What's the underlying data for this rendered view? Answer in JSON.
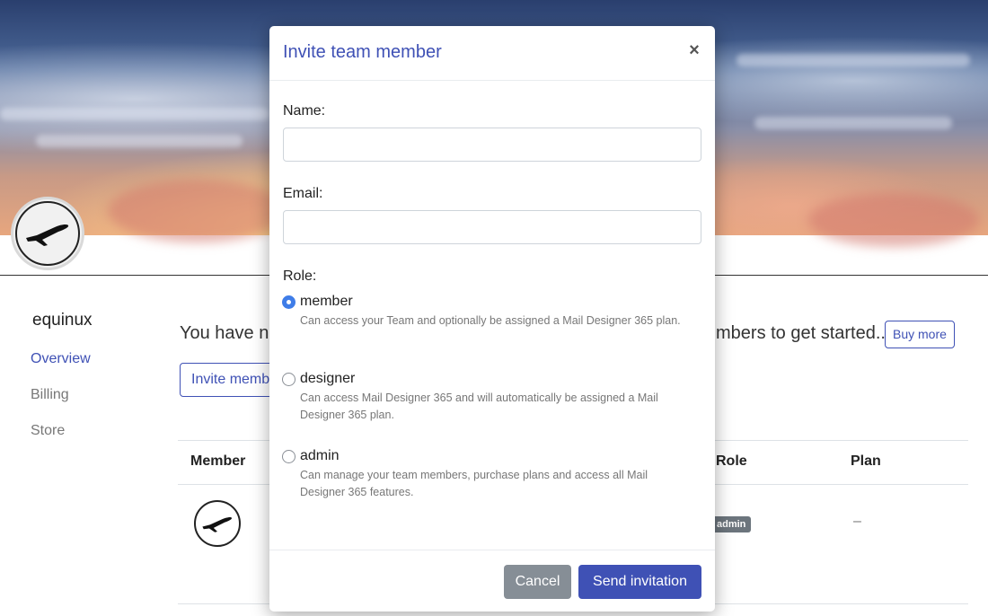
{
  "background": {
    "team_name": "equinux",
    "nav": [
      "Overview",
      "Billing",
      "Store"
    ],
    "notice_left": "You have no",
    "notice_right": "mbers to get started..",
    "buy_more_label": "Buy more",
    "invite_button_label": "Invite members",
    "table": {
      "headers": {
        "member": "Member",
        "role": "Role",
        "plan": "Plan"
      },
      "row": {
        "role_badge": "admin",
        "plan": "–"
      }
    }
  },
  "modal": {
    "title": "Invite team member",
    "close_glyph": "×",
    "name_label": "Name:",
    "name_value": "",
    "email_label": "Email:",
    "email_value": "",
    "role_label": "Role:",
    "roles": [
      {
        "label": "member",
        "description": "Can access your Team and optionally be assigned a Mail Designer 365 plan.",
        "checked": true
      },
      {
        "label": "designer",
        "description": "Can access Mail Designer 365 and will automatically be assigned a Mail Designer 365 plan.",
        "checked": false
      },
      {
        "label": "admin",
        "description": "Can manage your team members, purchase plans and access all Mail Designer 365 features.",
        "checked": false
      }
    ],
    "cancel_label": "Cancel",
    "send_label": "Send invitation"
  },
  "colors": {
    "accent": "#3f51b5",
    "radio_checked": "#3f7de8",
    "cancel_button": "#868e96"
  }
}
